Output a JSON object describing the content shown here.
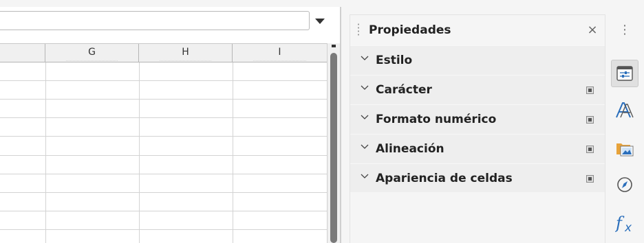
{
  "spreadsheet": {
    "columns": [
      "",
      "G",
      "H",
      "I"
    ]
  },
  "deck": {
    "title": "Propiedades",
    "close_glyph": "×",
    "panels": [
      {
        "label": "Estilo",
        "has_more": false
      },
      {
        "label": "Carácter",
        "has_more": true
      },
      {
        "label": "Formato numérico",
        "has_more": true
      },
      {
        "label": "Alineación",
        "has_more": true
      },
      {
        "label": "Apariencia de celdas",
        "has_more": true
      }
    ]
  },
  "tabbar": {
    "menu_glyph": "⋮",
    "tabs": [
      {
        "name": "properties",
        "icon": "properties-icon",
        "selected": true
      },
      {
        "name": "styles",
        "icon": "styles-icon"
      },
      {
        "name": "gallery",
        "icon": "gallery-icon"
      },
      {
        "name": "navigator",
        "icon": "navigator-icon"
      },
      {
        "name": "functions",
        "icon": "functions-icon"
      }
    ]
  },
  "colors": {
    "accent_blue": "#2a6ebb",
    "folder_orange": "#e8a33a"
  }
}
